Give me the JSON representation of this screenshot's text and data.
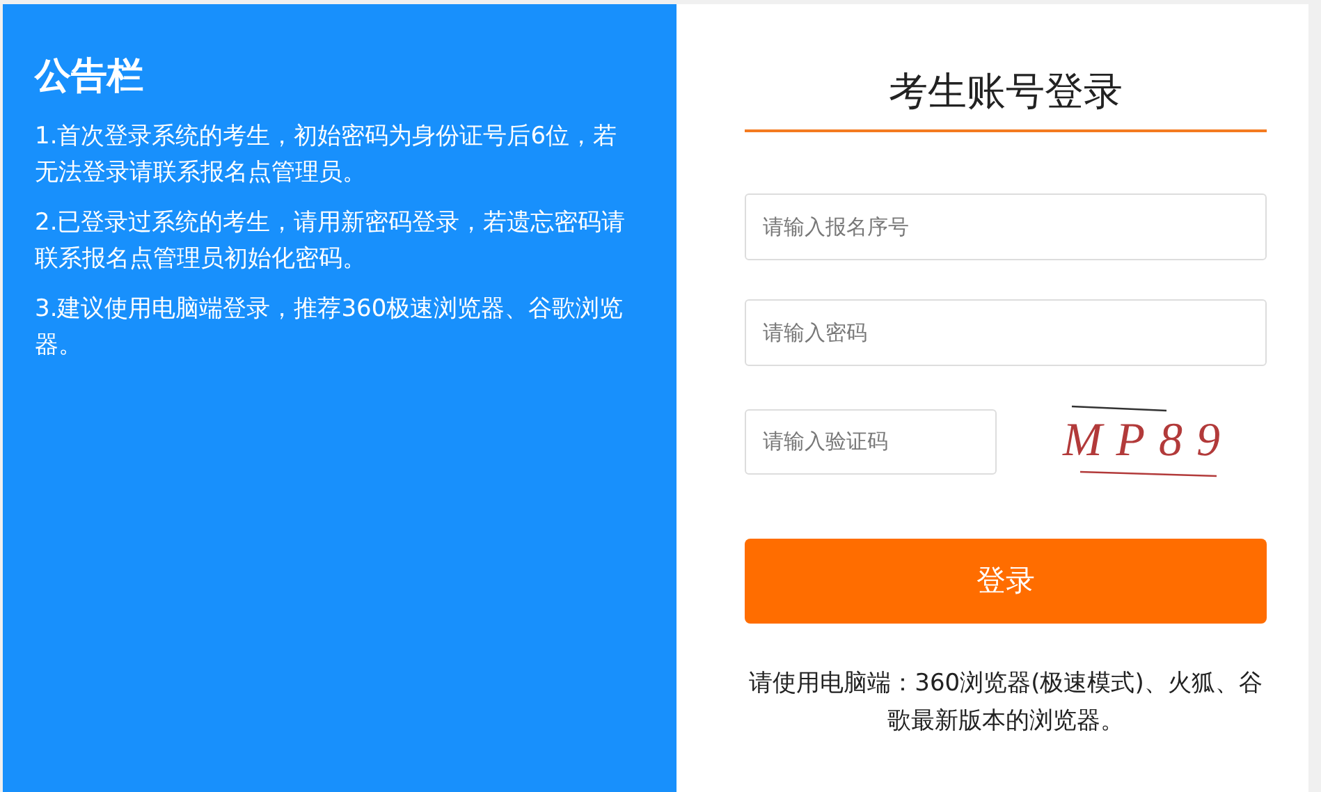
{
  "notice_board": {
    "title": "公告栏",
    "items": [
      "1.首次登录系统的考生，初始密码为身份证号后6位，若无法登录请联系报名点管理员。",
      "2.已登录过系统的考生，请用新密码登录，若遗忘密码请联系报名点管理员初始化密码。",
      "3.建议使用电脑端登录，推荐360极速浏览器、谷歌浏览器。"
    ]
  },
  "login": {
    "title": "考生账号登录",
    "fields": [
      {
        "placeholder": "请输入报名序号"
      },
      {
        "placeholder": "请输入密码"
      }
    ],
    "captcha": {
      "placeholder": "请输入验证码",
      "code": "MP89"
    },
    "button": "登录",
    "note": "请使用电脑端：360浏览器(极速模式)、火狐、谷歌最新版本的浏览器。"
  }
}
